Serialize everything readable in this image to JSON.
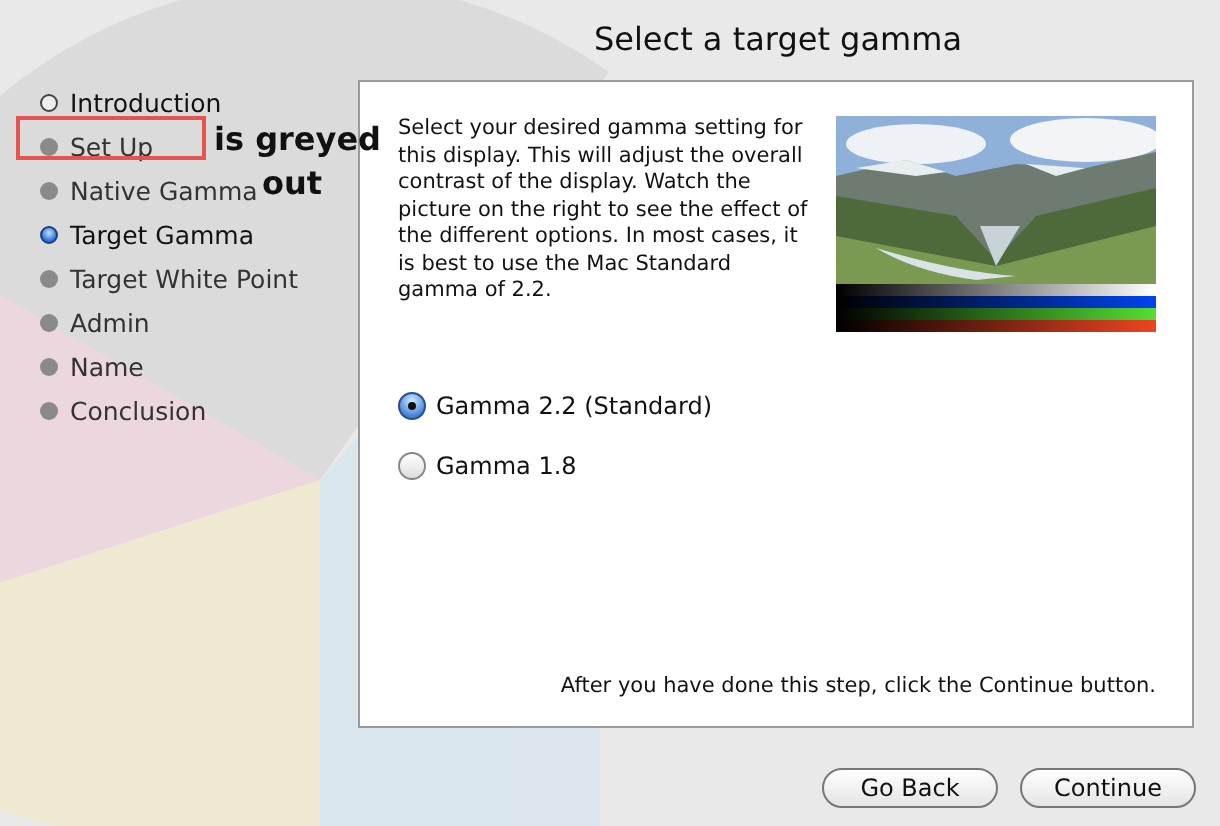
{
  "title": "Select a target gamma",
  "steps": [
    {
      "label": "Introduction",
      "done": true,
      "current": false
    },
    {
      "label": "Set Up",
      "done": false,
      "current": false
    },
    {
      "label": "Native Gamma",
      "done": false,
      "current": false
    },
    {
      "label": "Target Gamma",
      "done": false,
      "current": true
    },
    {
      "label": "Target White Point",
      "done": false,
      "current": false
    },
    {
      "label": "Admin",
      "done": false,
      "current": false
    },
    {
      "label": "Name",
      "done": false,
      "current": false
    },
    {
      "label": "Conclusion",
      "done": false,
      "current": false
    }
  ],
  "annotation": {
    "lines": [
      "is greyed",
      "out"
    ]
  },
  "description": "Select your desired gamma setting for this display. This will adjust the overall contrast of the display.  Watch the picture on the right to see the effect of the different options.  In most cases, it is best to use the Mac Standard gamma of 2.2.",
  "options": [
    {
      "label": "Gamma 2.2 (Standard)",
      "selected": true
    },
    {
      "label": "Gamma 1.8",
      "selected": false
    }
  ],
  "hint": "After you have done this step, click the Continue button.",
  "buttons": [
    "Go Back",
    "Continue"
  ]
}
